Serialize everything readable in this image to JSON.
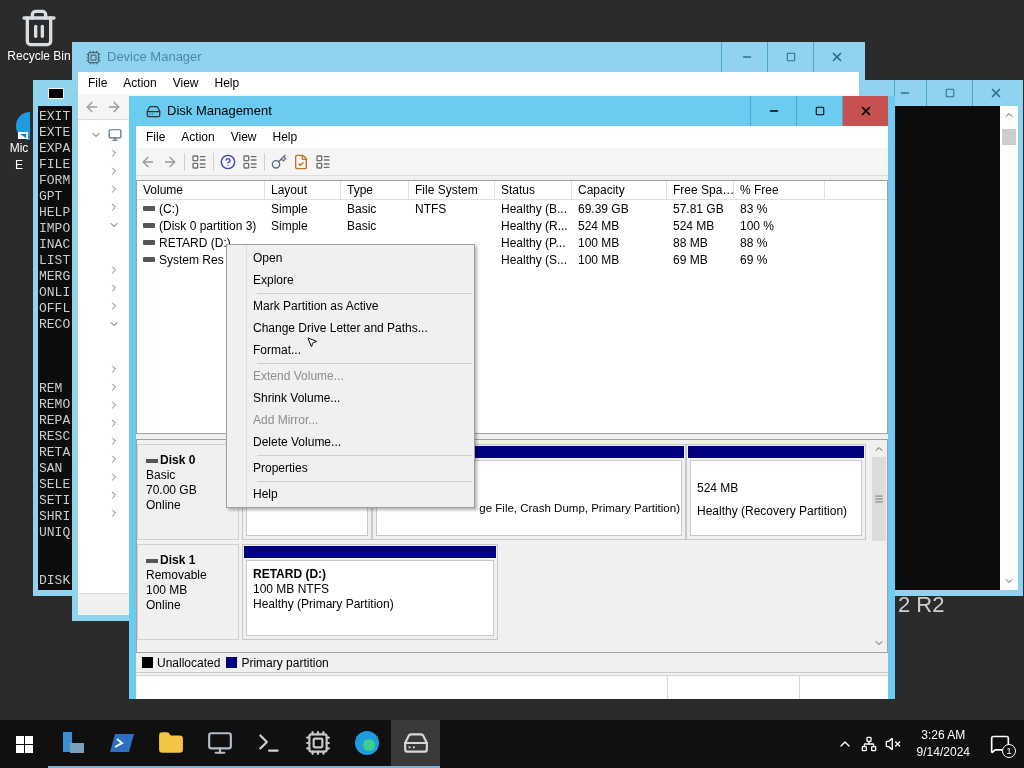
{
  "desktop": {
    "icons": [
      {
        "kind": "recycle-bin",
        "lines": [
          "Recycle Bin"
        ]
      },
      {
        "kind": "browser",
        "lines": [
          "Mic",
          "E"
        ]
      }
    ],
    "wallpaper_text": "2 R2"
  },
  "console_window": {
    "line_groups": [
      [
        "EXIT",
        "EXTE",
        "EXPA",
        "FILE",
        "FORM",
        "GPT",
        "HELP",
        "IMPO",
        "INAC",
        "LIST",
        "MERG",
        "ONLI",
        "OFFL",
        "RECO"
      ],
      [
        "REM",
        "REMO",
        "REPA",
        "RESC",
        "RETA",
        "SAN",
        "SELE",
        "SETI",
        "SHRI",
        "UNIQ"
      ],
      [
        "DISK"
      ]
    ]
  },
  "device_manager": {
    "title": "Device Manager",
    "menu": [
      "File",
      "Action",
      "View",
      "Help"
    ],
    "tree": {
      "expanded": true,
      "children": [
        {
          "expanded": false
        },
        {
          "expanded": false
        },
        {
          "expanded": false
        },
        {
          "expanded": false
        },
        {
          "expanded": true
        },
        {
          "expanded": false
        },
        {
          "expanded": false
        },
        {
          "expanded": false
        },
        {
          "expanded": true
        },
        {
          "expanded": false
        },
        {
          "expanded": false
        },
        {
          "expanded": false
        },
        {
          "expanded": false
        },
        {
          "expanded": false
        },
        {
          "expanded": false
        },
        {
          "expanded": false
        },
        {
          "expanded": false
        },
        {
          "expanded": false
        }
      ]
    }
  },
  "disk_management": {
    "title": "Disk Management",
    "menu": [
      "File",
      "Action",
      "View",
      "Help"
    ],
    "columns": [
      "Volume",
      "Layout",
      "Type",
      "File System",
      "Status",
      "Capacity",
      "Free Spa…",
      "% Free"
    ],
    "rows": [
      {
        "volume": "(C:)",
        "layout": "Simple",
        "type": "Basic",
        "file_system": "NTFS",
        "status": "Healthy (B...",
        "capacity": "69.39 GB",
        "free": "57.81 GB",
        "percent_free": "83 %"
      },
      {
        "volume": "(Disk 0 partition 3)",
        "layout": "Simple",
        "type": "Basic",
        "status": "Healthy (R...",
        "capacity": "524 MB",
        "free": "524 MB",
        "percent_free": "100 %"
      },
      {
        "volume": "RETARD (D:)",
        "status": "Healthy (P...",
        "capacity": "100 MB",
        "free": "88 MB",
        "percent_free": "88 %"
      },
      {
        "volume": "System Res",
        "status": "Healthy (S...",
        "capacity": "100 MB",
        "free": "69 MB",
        "percent_free": "69 %"
      }
    ],
    "disks": [
      {
        "name": "Disk 0",
        "lines": [
          "Basic",
          "70.00 GB",
          "Online"
        ],
        "partitions": [
          {
            "kind": "covered"
          },
          {
            "kind": "primary",
            "lines": [
              "ge File, Crash Dump, Primary Partition)"
            ]
          },
          {
            "kind": "primary",
            "lines": [
              "524 MB",
              "Healthy (Recovery Partition)"
            ]
          }
        ]
      },
      {
        "name": "Disk 1",
        "lines": [
          "Removable",
          "100 MB",
          "Online"
        ],
        "partitions": [
          {
            "kind": "primary",
            "title": "RETARD  (D:)",
            "lines": [
              "100 MB NTFS",
              "Healthy (Primary Partition)"
            ]
          }
        ]
      }
    ],
    "legend": [
      {
        "label": "Unallocated",
        "color": "#000000"
      },
      {
        "label": "Primary partition",
        "color": "#000080"
      }
    ]
  },
  "context_menu": [
    {
      "kind": "item",
      "label": "Open",
      "disabled": false
    },
    {
      "kind": "item",
      "label": "Explore",
      "disabled": false
    },
    {
      "kind": "separator"
    },
    {
      "kind": "item",
      "label": "Mark Partition as Active",
      "disabled": false
    },
    {
      "kind": "item",
      "label": "Change Drive Letter and Paths...",
      "disabled": false
    },
    {
      "kind": "item",
      "label": "Format...",
      "disabled": false
    },
    {
      "kind": "separator"
    },
    {
      "kind": "item",
      "label": "Extend Volume...",
      "disabled": true
    },
    {
      "kind": "item",
      "label": "Shrink Volume...",
      "disabled": false
    },
    {
      "kind": "item",
      "label": "Add Mirror...",
      "disabled": true
    },
    {
      "kind": "item",
      "label": "Delete Volume...",
      "disabled": false
    },
    {
      "kind": "separator"
    },
    {
      "kind": "item",
      "label": "Properties",
      "disabled": false
    },
    {
      "kind": "separator"
    },
    {
      "kind": "item",
      "label": "Help",
      "disabled": false
    }
  ],
  "taskbar": {
    "apps": [
      {
        "kind": "server-manager",
        "selected": false
      },
      {
        "kind": "powershell",
        "selected": false
      },
      {
        "kind": "folder",
        "selected": false
      },
      {
        "kind": "computer",
        "selected": false
      },
      {
        "kind": "console",
        "selected": false
      },
      {
        "kind": "devices",
        "selected": false
      },
      {
        "kind": "browser",
        "selected": false
      },
      {
        "kind": "disk",
        "selected": true
      }
    ],
    "time": "3:26 AM",
    "date": "9/14/2024",
    "notifications": "1"
  }
}
